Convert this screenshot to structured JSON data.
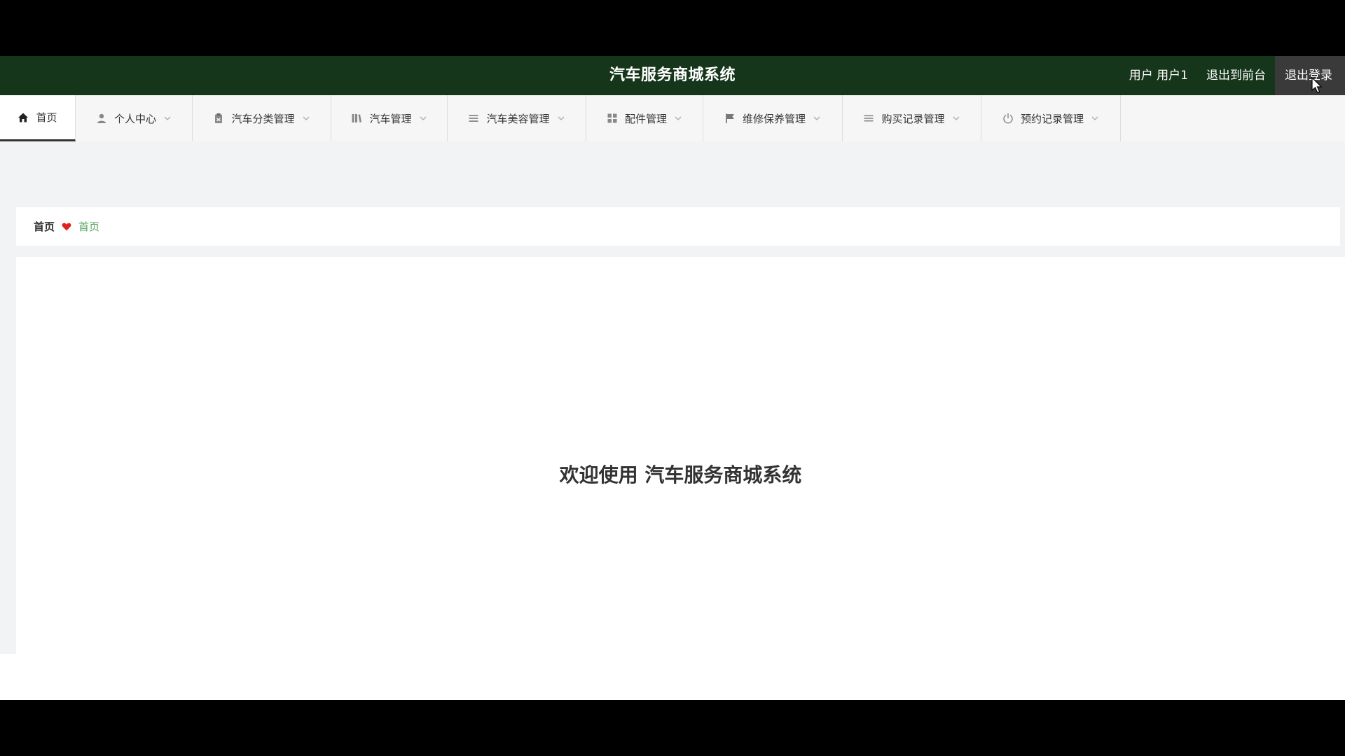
{
  "header": {
    "title": "汽车服务商城系统",
    "user_label": "用户 用户1",
    "back_to_front_label": "退出到前台",
    "logout_label": "退出登录"
  },
  "nav": {
    "items": [
      {
        "label": "首页",
        "icon": "home-icon",
        "active": true
      },
      {
        "label": "个人中心",
        "icon": "user-icon"
      },
      {
        "label": "汽车分类管理",
        "icon": "clipboard-icon"
      },
      {
        "label": "汽车管理",
        "icon": "library-icon"
      },
      {
        "label": "汽车美容管理",
        "icon": "list-icon"
      },
      {
        "label": "配件管理",
        "icon": "grid-icon"
      },
      {
        "label": "维修保养管理",
        "icon": "flag-icon"
      },
      {
        "label": "购买记录管理",
        "icon": "menu-icon"
      },
      {
        "label": "预约记录管理",
        "icon": "power-icon"
      }
    ]
  },
  "breadcrumb": {
    "home": "首页",
    "current": "首页"
  },
  "main": {
    "welcome_text": "欢迎使用 汽车服务商城系统"
  },
  "colors": {
    "header_bg": "#15361b",
    "accent_green": "#5aa35e",
    "heart_red": "#e02020"
  }
}
